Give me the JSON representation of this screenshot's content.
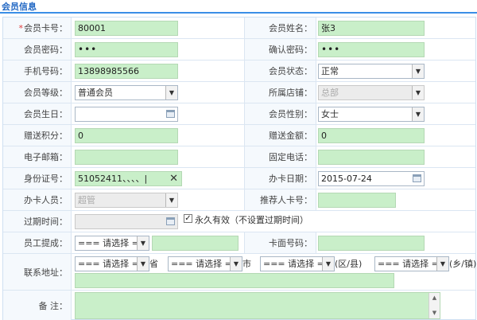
{
  "section_title": "会员信息",
  "labels": {
    "card_no": "会员卡号：",
    "name": "会员姓名：",
    "password": "会员密码：",
    "confirm_password": "确认密码：",
    "phone": "手机号码：",
    "status": "会员状态：",
    "level": "会员等级：",
    "store": "所属店铺：",
    "birthday": "会员生日：",
    "gender": "会员性别：",
    "points": "赠送积分：",
    "amount": "赠送金额：",
    "email": "电子邮箱：",
    "landline": "固定电话：",
    "id_card": "身份证号：",
    "issue_date": "办卡日期：",
    "issuer": "办卡人员：",
    "referrer": "推荐人卡号：",
    "expire": "过期时间：",
    "commission": "员工提成：",
    "card_face": "卡面号码：",
    "address": "联系地址：",
    "remark": "备 注："
  },
  "required_mark": "*",
  "values": {
    "card_no": "80001",
    "name": "张3",
    "password": "•••",
    "confirm_password": "•••",
    "phone": "13898985566",
    "status": "正常",
    "level": "普通会员",
    "store": "总部",
    "birthday": "",
    "gender": "女士",
    "points": "0",
    "amount": "0",
    "email": "",
    "landline": "",
    "id_card": "51052411、、、、|",
    "issue_date": "2015-07-24",
    "issuer": "超管",
    "referrer": "",
    "expire": "",
    "commission_select": "=== 请选择 ===",
    "commission_value": "",
    "card_face": "",
    "address_detail": "",
    "remark": ""
  },
  "permanent": {
    "checked": true,
    "label": "永久有效（不设置过期时间）"
  },
  "address": {
    "province_select": "=== 请选择 ===",
    "province_suffix": "省",
    "city_select": "=== 请选择 ===",
    "city_suffix": "市",
    "district_select": "=== 请选择 ===",
    "district_suffix": "(区/县)",
    "town_select": "=== 请选择 ===",
    "town_suffix": "(乡/镇)"
  },
  "icons": {
    "dropdown": "▼",
    "clear": "✕",
    "check": "✓"
  },
  "colors": {
    "accent": "#3a8ee6",
    "input_green": "#c9efc9",
    "required": "#e03b3b"
  }
}
